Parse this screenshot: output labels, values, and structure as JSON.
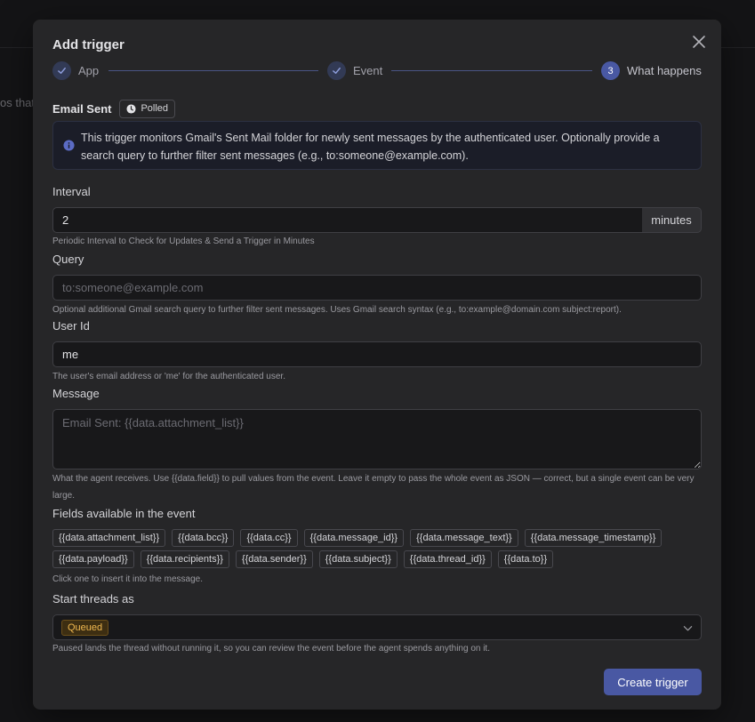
{
  "background": {
    "partial_text": "os that"
  },
  "modal": {
    "title": "Add trigger"
  },
  "stepper": {
    "steps": [
      {
        "label": "App",
        "state": "done"
      },
      {
        "label": "Event",
        "state": "done"
      },
      {
        "label": "What happens",
        "state": "active",
        "number": "3"
      }
    ]
  },
  "event": {
    "name": "Email Sent",
    "badge": "Polled",
    "description": "This trigger monitors Gmail's Sent Mail folder for newly sent messages by the authenticated user. Optionally provide a search query to further filter sent messages (e.g., to:someone@example.com)."
  },
  "fields": {
    "interval": {
      "label": "Interval",
      "value": "2",
      "unit": "minutes",
      "hint": "Periodic Interval to Check for Updates & Send a Trigger in Minutes"
    },
    "query": {
      "label": "Query",
      "value": "",
      "placeholder": "to:someone@example.com",
      "hint": "Optional additional Gmail search query to further filter sent messages. Uses Gmail search syntax (e.g., to:example@domain.com subject:report)."
    },
    "user_id": {
      "label": "User Id",
      "value": "me",
      "hint": "The user's email address or 'me' for the authenticated user."
    },
    "message": {
      "label": "Message",
      "value": "",
      "placeholder": "Email Sent: {{data.attachment_list}}",
      "hint": "What the agent receives. Use {{data.field}} to pull values from the event. Leave it empty to pass the whole event as JSON — correct, but a single event can be very large."
    }
  },
  "available_fields": {
    "label": "Fields available in the event",
    "row1": [
      "{{data.attachment_list}}",
      "{{data.bcc}}",
      "{{data.cc}}",
      "{{data.message_id}}",
      "{{data.message_text}}",
      "{{data.message_timestamp}}"
    ],
    "row2": [
      "{{data.payload}}",
      "{{data.recipients}}",
      "{{data.sender}}",
      "{{data.subject}}",
      "{{data.thread_id}}",
      "{{data.to}}"
    ],
    "hint": "Click one to insert it into the message."
  },
  "start_threads": {
    "label": "Start threads as",
    "selected": "Queued",
    "hint": "Paused lands the thread without running it, so you can review the event before the agent spends anything on it."
  },
  "actions": {
    "create_label": "Create trigger"
  },
  "colors": {
    "accent": "#4958a3",
    "queued": "#f0b850"
  },
  "icons": {
    "close": "close-icon",
    "check": "check-icon",
    "info": "info-icon",
    "clock": "clock-icon",
    "chevron": "chevron-down-icon"
  }
}
